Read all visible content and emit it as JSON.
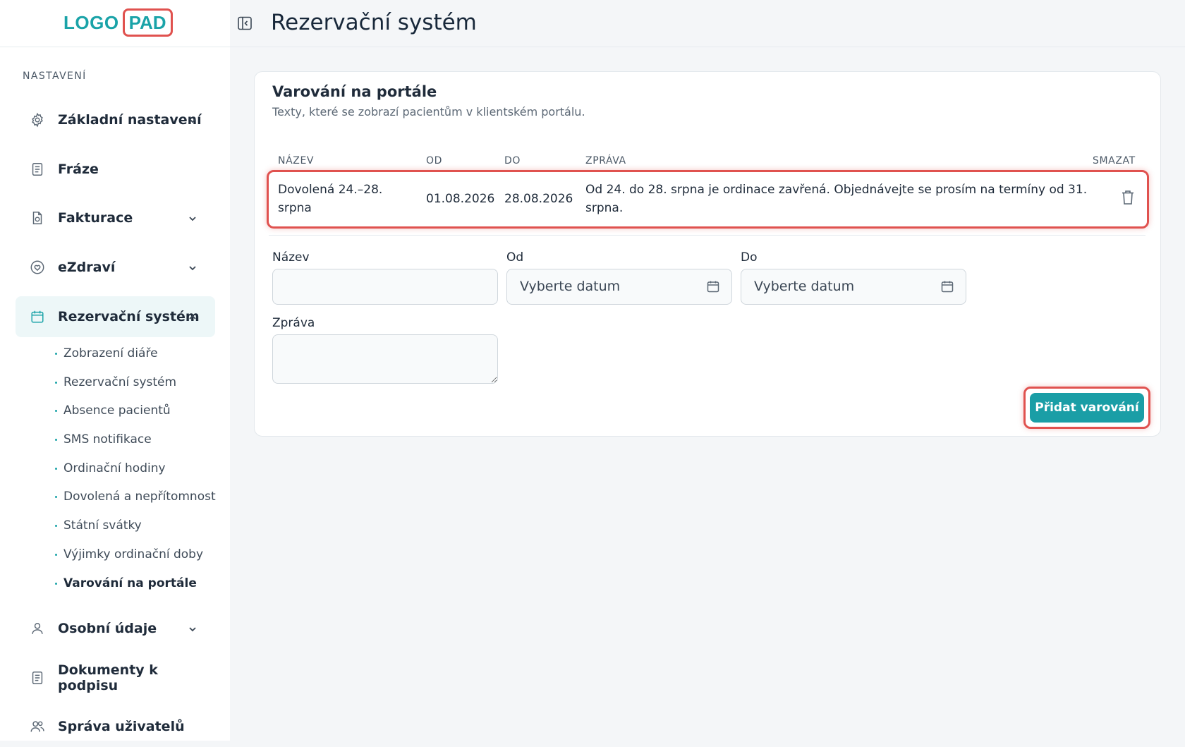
{
  "logo": {
    "part1": "LOGO",
    "part2": "PAD"
  },
  "header": {
    "title": "Rezervační systém"
  },
  "sidebar": {
    "section_label": "NASTAVENÍ",
    "items": [
      {
        "label": "Základní nastavení",
        "icon": "gear-icon",
        "chevron": "down"
      },
      {
        "label": "Fráze",
        "icon": "document-icon"
      },
      {
        "label": "Fakturace",
        "icon": "invoice-icon",
        "chevron": "down"
      },
      {
        "label": "eZdraví",
        "icon": "heart-icon",
        "chevron": "down"
      },
      {
        "label": "Rezervační systém",
        "icon": "calendar-icon",
        "chevron": "up",
        "active": true
      },
      {
        "label": "Osobní údaje",
        "icon": "user-icon",
        "chevron": "down"
      },
      {
        "label": "Dokumenty k podpisu",
        "icon": "document-icon"
      },
      {
        "label": "Správa uživatelů",
        "icon": "users-icon"
      }
    ],
    "subitems": [
      {
        "label": "Zobrazení diáře"
      },
      {
        "label": "Rezervační systém"
      },
      {
        "label": "Absence pacientů"
      },
      {
        "label": "SMS notifikace"
      },
      {
        "label": "Ordinační hodiny"
      },
      {
        "label": "Dovolená a nepřítomnost"
      },
      {
        "label": "Státní svátky"
      },
      {
        "label": "Výjimky ordinační doby"
      },
      {
        "label": "Varování na portále",
        "current": true
      }
    ]
  },
  "card": {
    "title": "Varování na portále",
    "subtitle": "Texty, které se zobrazí pacientům v klientském portálu.",
    "columns": {
      "name": "NÁZEV",
      "from": "OD",
      "to": "DO",
      "message": "ZPRÁVA",
      "delete": "SMAZAT"
    },
    "rows": [
      {
        "name_line1": "Dovolená 24.–28.",
        "name_line2": "srpna",
        "from": "01.08.2026",
        "to": "28.08.2026",
        "message_line1": "Od 24. do 28. srpna je ordinace zavřená. Objednávejte se prosím na termíny od 31.",
        "message_line2": "srpna."
      }
    ],
    "form": {
      "name_label": "Název",
      "from_label": "Od",
      "to_label": "Do",
      "message_label": "Zpráva",
      "from_placeholder": "Vyberte datum",
      "to_placeholder": "Vyberte datum",
      "submit_label": "Přidat varování"
    }
  },
  "colors": {
    "accent": "#1a9ea6",
    "highlight": "#e0524f",
    "text": "#1f2b3a"
  }
}
